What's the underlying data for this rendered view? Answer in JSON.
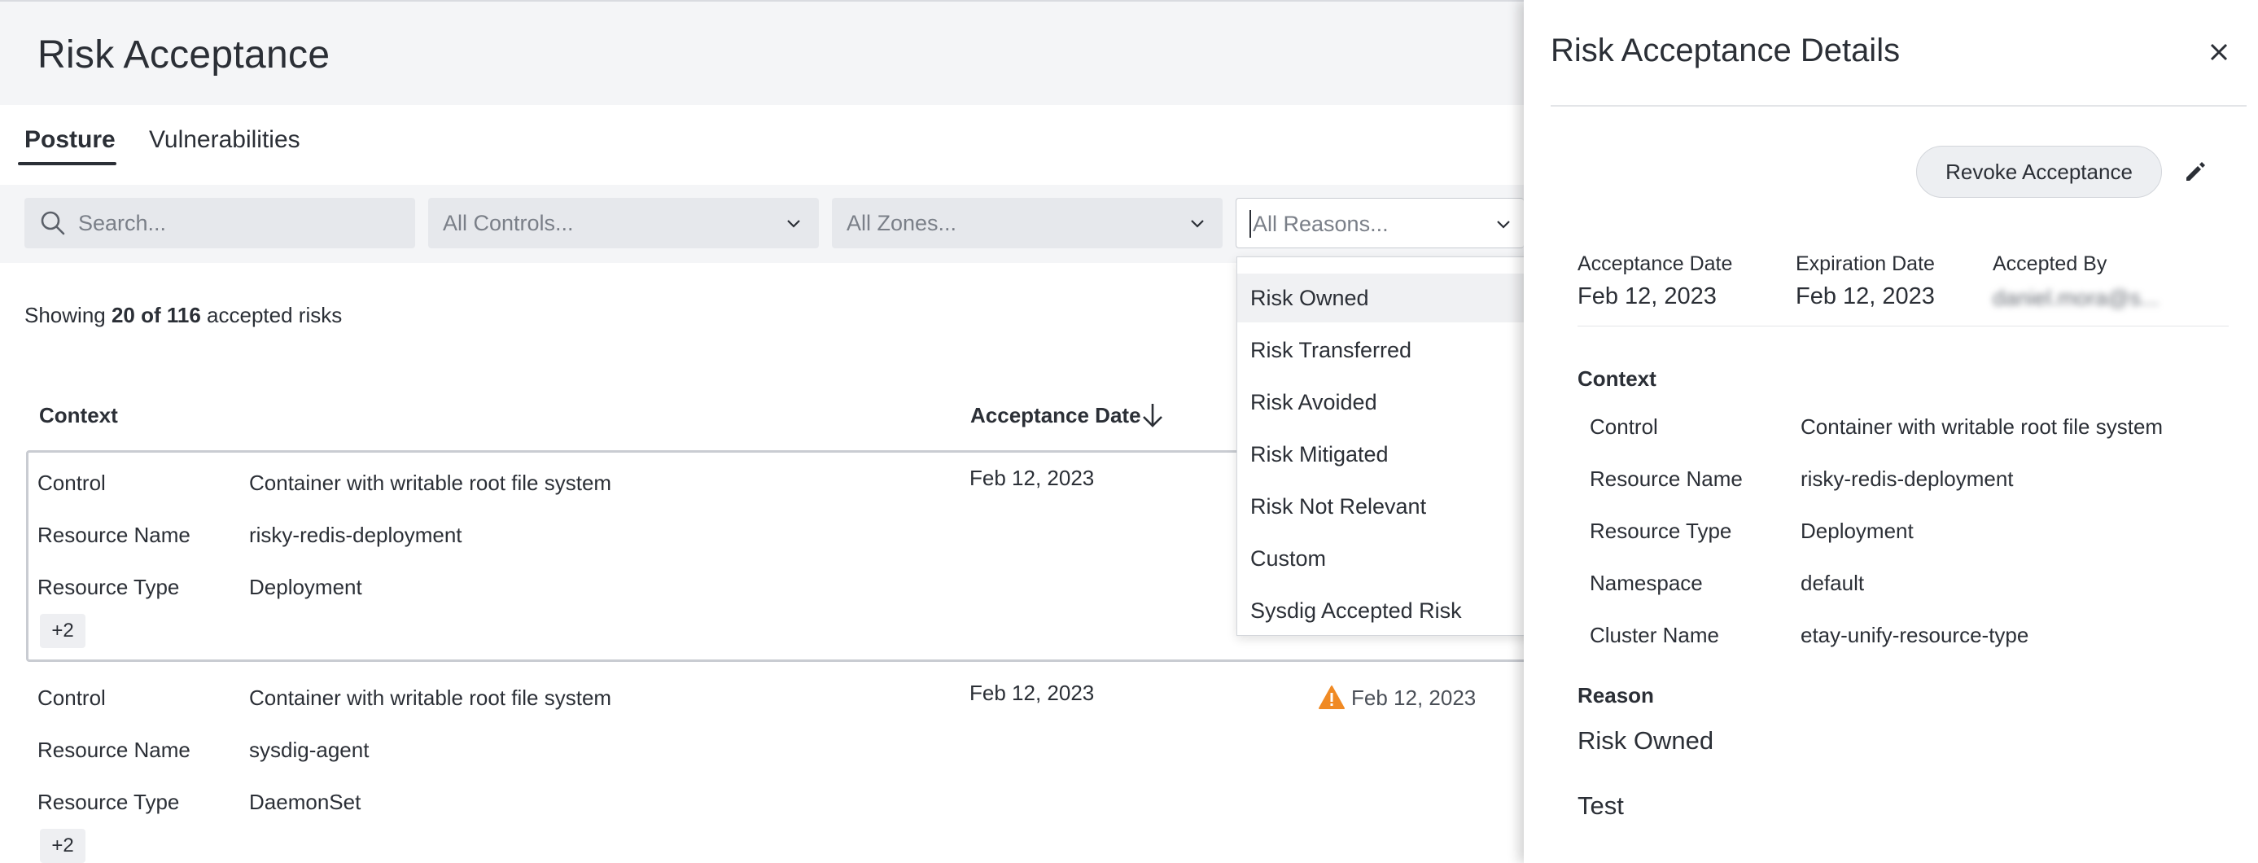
{
  "page": {
    "title": "Risk Acceptance"
  },
  "tabs": [
    {
      "label": "Posture",
      "active": true
    },
    {
      "label": "Vulnerabilities",
      "active": false
    }
  ],
  "filters": {
    "search_placeholder": "Search...",
    "controls_placeholder": "All Controls...",
    "zones_placeholder": "All Zones...",
    "reasons_placeholder": "All Reasons..."
  },
  "summary": {
    "prefix": "Showing ",
    "count": "20 of 116",
    "suffix": " accepted risks"
  },
  "table": {
    "headers": {
      "context": "Context",
      "acceptance_date": "Acceptance Date"
    },
    "rows": [
      {
        "control_label": "Control",
        "control": "Container with writable root file system",
        "resource_name_label": "Resource Name",
        "resource_name": "risky-redis-deployment",
        "resource_type_label": "Resource Type",
        "resource_type": "Deployment",
        "more": "+2",
        "acceptance_date": "Feb 12, 2023"
      },
      {
        "control_label": "Control",
        "control": "Container with writable root file system",
        "resource_name_label": "Resource Name",
        "resource_name": "sysdig-agent",
        "resource_type_label": "Resource Type",
        "resource_type": "DaemonSet",
        "more": "+2",
        "acceptance_date": "Feb 12, 2023",
        "expiration_date": "Feb 12, 2023"
      }
    ]
  },
  "reasons_dropdown": {
    "options": [
      "Risk Owned",
      "Risk Transferred",
      "Risk Avoided",
      "Risk Mitigated",
      "Risk Not Relevant",
      "Custom",
      "Sysdig Accepted Risk"
    ],
    "highlighted": "Risk Owned"
  },
  "details": {
    "title": "Risk Acceptance Details",
    "revoke_label": "Revoke Acceptance",
    "acceptance_date_label": "Acceptance Date",
    "acceptance_date": "Feb 12, 2023",
    "expiration_date_label": "Expiration Date",
    "expiration_date": "Feb 12, 2023",
    "accepted_by_label": "Accepted By",
    "accepted_by": "daniel.mora@s...",
    "context_label": "Context",
    "context": [
      {
        "key": "Control",
        "value": "Container with writable root file system"
      },
      {
        "key": "Resource Name",
        "value": "risky-redis-deployment"
      },
      {
        "key": "Resource Type",
        "value": "Deployment"
      },
      {
        "key": "Namespace",
        "value": "default"
      },
      {
        "key": "Cluster Name",
        "value": "etay-unify-resource-type"
      }
    ],
    "reason_label": "Reason",
    "reason": "Risk Owned",
    "description": "Test"
  },
  "colors": {
    "warning": "#f08a24",
    "header_bg": "#f4f5f7"
  },
  "icons": [
    "search-icon",
    "chevron-down-icon",
    "sort-down-icon",
    "warning-icon",
    "close-icon",
    "edit-icon"
  ]
}
